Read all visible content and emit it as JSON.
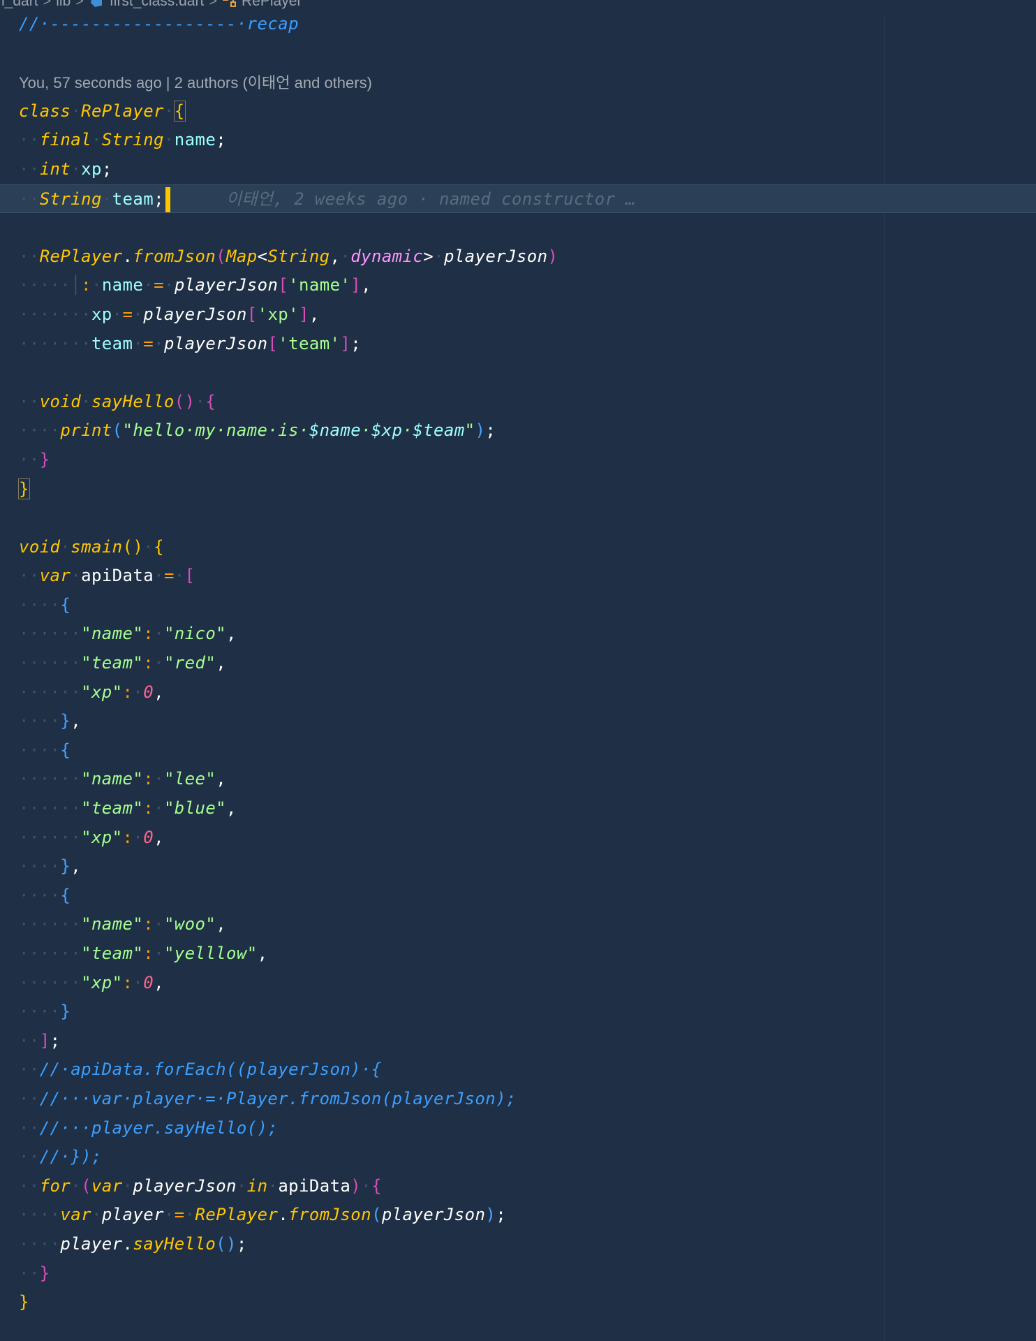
{
  "breadcrumb": {
    "project": "rn_dart",
    "folder": "lib",
    "file": "first_class.dart",
    "symbol": "RePlayer",
    "file_icon": "dart-icon",
    "symbol_icon": "class-icon"
  },
  "codelens": "You, 57 seconds ago | 2 authors (이태언 and others)",
  "blame": {
    "author": "이태언",
    "detail": ", 2 weeks ago · named constructor …"
  },
  "colors": {
    "background": "#1f2f45",
    "keyword": "#ffc600",
    "string": "#a5ff90",
    "comment": "#3a9fff",
    "field": "#9effff",
    "number": "#ff628c"
  }
}
